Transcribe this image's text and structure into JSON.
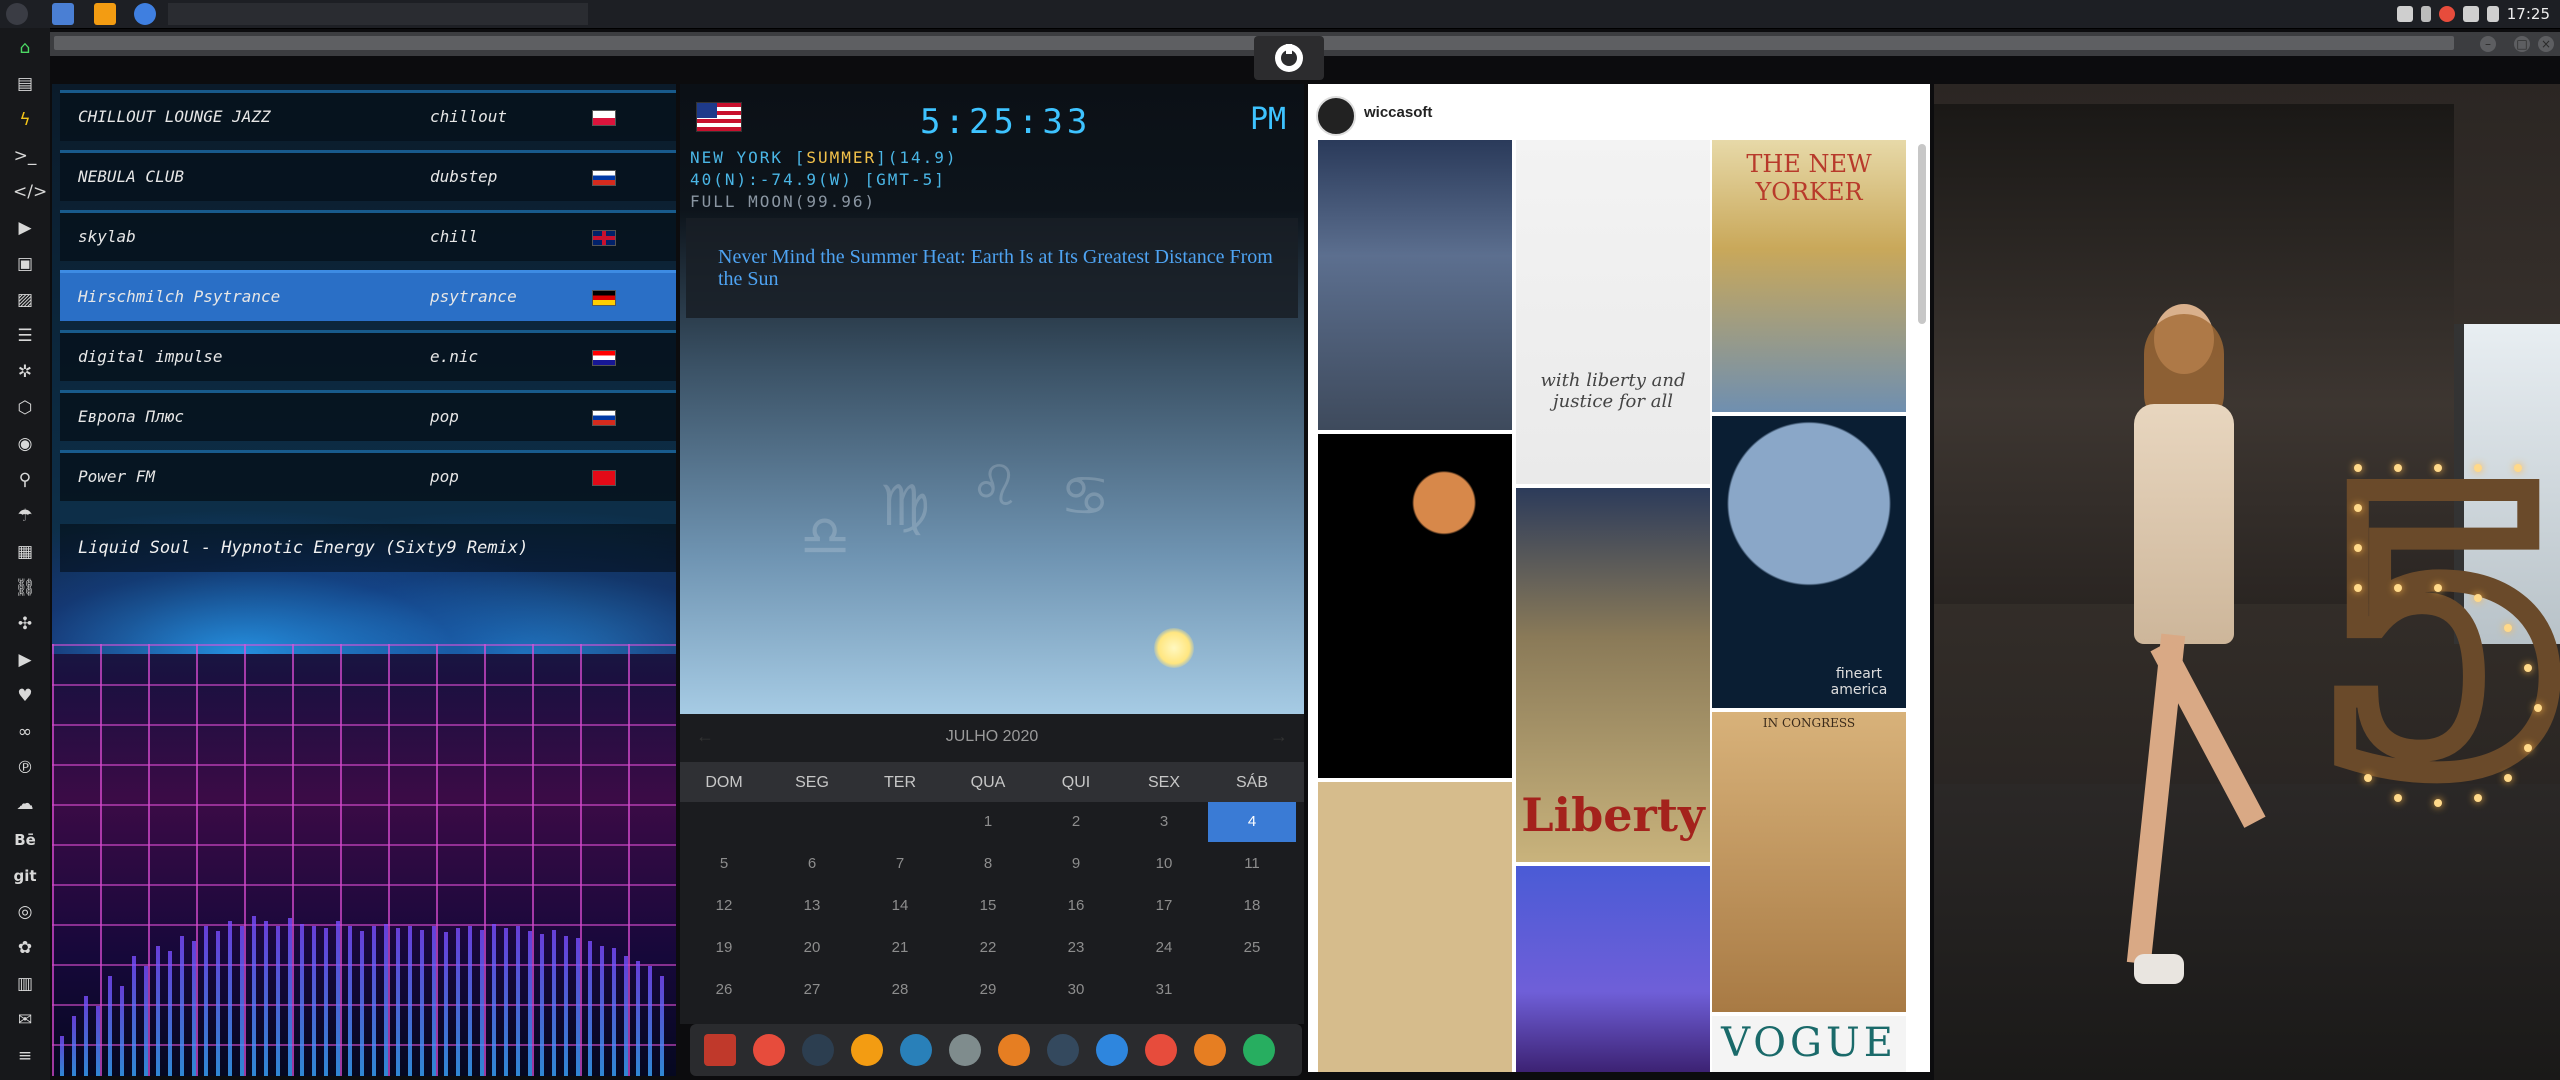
{
  "topbar": {
    "clock": "17:25",
    "app_icons": [
      "menu-icon",
      "files-icon",
      "sublime-icon",
      "chrome-icon"
    ],
    "tray_icons": [
      "screenshot-icon",
      "bluetooth-icon",
      "settings-icon",
      "volume-icon",
      "wifi-icon"
    ]
  },
  "leftdock": {
    "icons": [
      "home-icon",
      "document-icon",
      "lightning-icon",
      "terminal-icon",
      "code-icon",
      "play-icon",
      "files-icon",
      "image-icon",
      "reader-icon",
      "gear-icon",
      "hexagon-icon",
      "globe-icon",
      "search-icon",
      "umbrella-icon",
      "contacts-icon",
      "link-icon",
      "expand-icon",
      "youtube-icon",
      "heart-icon",
      "infinity-icon",
      "pinterest-icon",
      "cloud-icon"
    ],
    "text_items": [
      "Bē",
      "git"
    ],
    "bottom_icons": [
      "github-icon",
      "network-icon",
      "map-icon",
      "mail-icon",
      "list-icon"
    ]
  },
  "radio": {
    "stations": [
      {
        "name": "CHILLOUT LOUNGE JAZZ",
        "genre": "chillout",
        "flag": "pl",
        "selected": false
      },
      {
        "name": "NEBULA CLUB",
        "genre": "dubstep",
        "flag": "ru",
        "selected": false
      },
      {
        "name": "skylab",
        "genre": "chill",
        "flag": "uk",
        "selected": false
      },
      {
        "name": "Hirschmilch Psytrance",
        "genre": "psytrance",
        "flag": "de",
        "selected": true
      },
      {
        "name": "digital impulse",
        "genre": "e.nic",
        "flag": "hr",
        "selected": false
      },
      {
        "name": "Европа Плюс",
        "genre": "pop",
        "flag": "ru",
        "selected": false
      },
      {
        "name": "Power FM",
        "genre": "pop",
        "flag": "tr",
        "selected": false
      }
    ],
    "now_playing": "Liquid Soul - Hypnotic Energy (Sixty9 Remix)"
  },
  "clock": {
    "time": "5:25:33",
    "ampm": "PM",
    "city_line_pre": "NEW YORK [",
    "city_line_season": "SUMMER",
    "city_line_post": "](14.9)",
    "coords_line": "40(N):-74.9(W) [GMT-5]",
    "moon_line": "FULL MOON(99.96)",
    "news": "Never Mind the Summer Heat: Earth Is at Its Greatest Distance From the Sun"
  },
  "calendar": {
    "month": "JULHO 2020",
    "weekdays": [
      "DOM",
      "SEG",
      "TER",
      "QUA",
      "QUI",
      "SEX",
      "SÁB"
    ],
    "weeks": [
      [
        "",
        "",
        "",
        "1",
        "2",
        "3",
        "4"
      ],
      [
        "5",
        "6",
        "7",
        "8",
        "9",
        "10",
        "11"
      ],
      [
        "12",
        "13",
        "14",
        "15",
        "16",
        "17",
        "18"
      ],
      [
        "19",
        "20",
        "21",
        "22",
        "23",
        "24",
        "25"
      ],
      [
        "26",
        "27",
        "28",
        "29",
        "30",
        "31",
        ""
      ]
    ],
    "today": "4"
  },
  "bottomdock": {
    "icons": [
      "appmenu-icon",
      "timer-icon",
      "globe-dark-icon",
      "photos-icon",
      "translate-icon",
      "notes-icon",
      "search-icon",
      "clock-icon",
      "web-icon",
      "calendar-icon",
      "arrow-icon",
      "yandex-icon"
    ],
    "colors": [
      "#c0392b",
      "#e74c3c",
      "#2c3e50",
      "#f39c12",
      "#2980b9",
      "#7f8c8d",
      "#e67e22",
      "#34495e",
      "#2e86de",
      "#e74c3c",
      "#e67e22",
      "#27ae60"
    ]
  },
  "instagram": {
    "username": "wiccasoft",
    "tiles": [
      {
        "caption": ""
      },
      {
        "caption": "with liberty and justice for all"
      },
      {
        "caption": "THE NEW YORKER"
      },
      {
        "caption": ""
      },
      {
        "caption": "Liberty"
      },
      {
        "caption": "fineart america"
      },
      {
        "caption": ""
      },
      {
        "caption": ""
      },
      {
        "caption": "IN CONGRESS"
      },
      {
        "caption": "VOGUE"
      }
    ]
  },
  "colors": {
    "accent": "#3ec3ff",
    "selected_row": "#2a6fc6",
    "today": "#3a7bd5",
    "news": "#4ea3f2"
  }
}
